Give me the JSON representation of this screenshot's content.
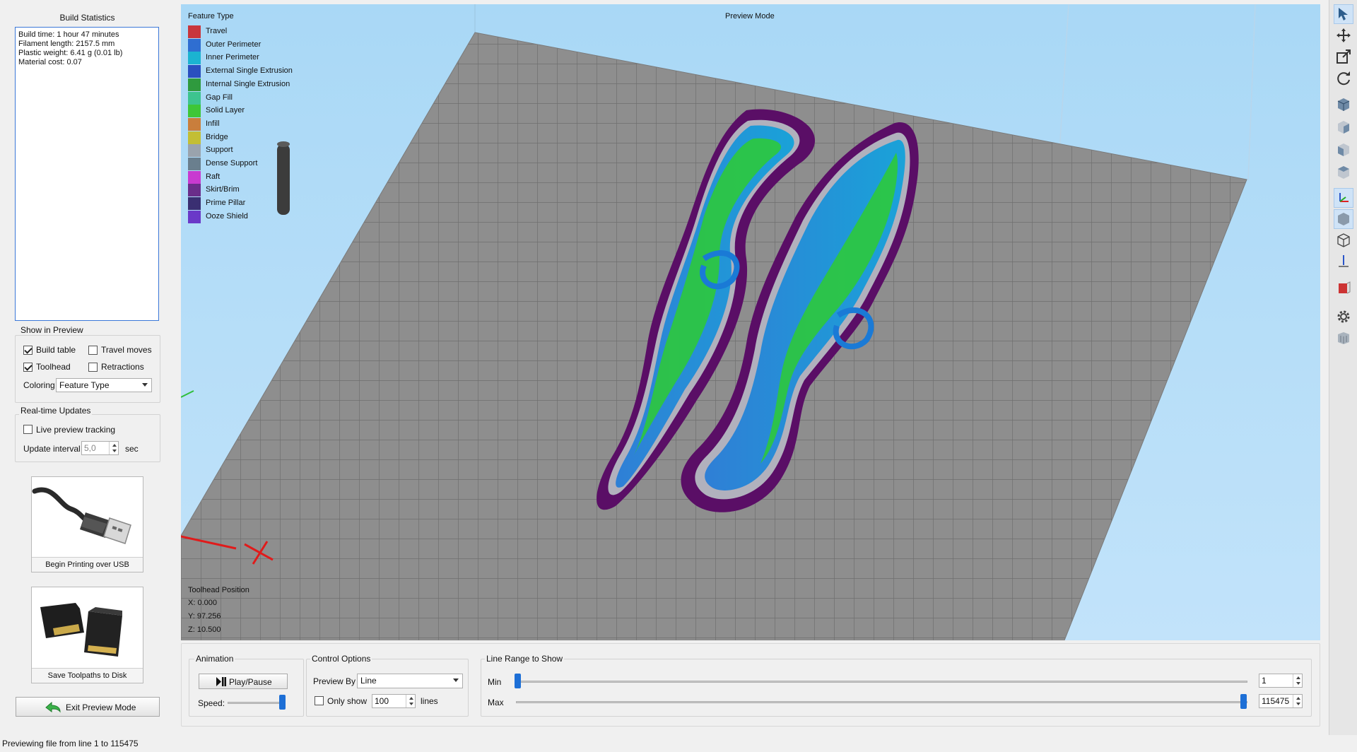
{
  "left_panel": {
    "build_statistics_title": "Build Statistics",
    "stats_lines": [
      "Build time: 1 hour 47 minutes",
      "Filament length: 2157.5 mm",
      "Plastic weight: 6.41 g (0.01 lb)",
      "Material cost: 0.07"
    ],
    "show_in_preview": {
      "title": "Show in Preview",
      "build_table": "Build table",
      "build_table_checked": true,
      "travel_moves": "Travel moves",
      "travel_moves_checked": false,
      "toolhead": "Toolhead",
      "toolhead_checked": true,
      "retractions": "Retractions",
      "retractions_checked": false,
      "coloring_label": "Coloring",
      "coloring_value": "Feature Type"
    },
    "realtime_updates": {
      "title": "Real-time Updates",
      "live_preview_tracking": "Live preview tracking",
      "live_preview_checked": false,
      "update_interval_label": "Update interval",
      "update_interval_value": "5,0",
      "update_interval_unit": "sec"
    },
    "begin_usb_label": "Begin Printing over USB",
    "save_toolpaths_label": "Save Toolpaths to Disk",
    "exit_preview_label": "Exit Preview Mode"
  },
  "viewport": {
    "mode_title": "Preview Mode",
    "legend_title": "Feature Type",
    "legend": [
      {
        "label": "Travel",
        "color": "#c8363c"
      },
      {
        "label": "Outer Perimeter",
        "color": "#2f6ed1"
      },
      {
        "label": "Inner Perimeter",
        "color": "#1bb3d1"
      },
      {
        "label": "External Single Extrusion",
        "color": "#2a4fbf"
      },
      {
        "label": "Internal Single Extrusion",
        "color": "#2f9a3e"
      },
      {
        "label": "Gap Fill",
        "color": "#3dc48f"
      },
      {
        "label": "Solid Layer",
        "color": "#3ec637"
      },
      {
        "label": "Infill",
        "color": "#c97e3c"
      },
      {
        "label": "Bridge",
        "color": "#c3be34"
      },
      {
        "label": "Support",
        "color": "#9aa3ad"
      },
      {
        "label": "Dense Support",
        "color": "#6a7f8e"
      },
      {
        "label": "Raft",
        "color": "#c83ad0"
      },
      {
        "label": "Skirt/Brim",
        "color": "#6a2d8a"
      },
      {
        "label": "Prime Pillar",
        "color": "#3a2f72"
      },
      {
        "label": "Ooze Shield",
        "color": "#6a39c8"
      }
    ],
    "toolhead_position_title": "Toolhead Position",
    "toolhead_x": "X: 0.000",
    "toolhead_y": "Y: 97.256",
    "toolhead_z": "Z: 10.500"
  },
  "bottom": {
    "animation_title": "Animation",
    "play_pause_label": "Play/Pause",
    "speed_label": "Speed:",
    "control_options_title": "Control Options",
    "preview_by_label": "Preview By",
    "preview_by_value": "Line",
    "only_show_label": "Only show",
    "only_show_checked": false,
    "only_show_value": "100",
    "lines_label": "lines",
    "line_range_title": "Line Range to Show",
    "min_label": "Min",
    "max_label": "Max",
    "min_value": "1",
    "max_value": "115475"
  },
  "status_bar": "Previewing file from line 1 to 115475",
  "toolbar_icons": [
    "select-cursor-icon",
    "move-icon",
    "scale-icon",
    "rotate-icon",
    "view-iso-icon",
    "view-front-icon",
    "view-side-icon",
    "view-top-icon",
    "axes-icon",
    "solid-view-icon",
    "wireframe-view-icon",
    "z-axis-icon",
    "section-view-icon",
    "settings-gear-icon",
    "build-plate-icon"
  ]
}
